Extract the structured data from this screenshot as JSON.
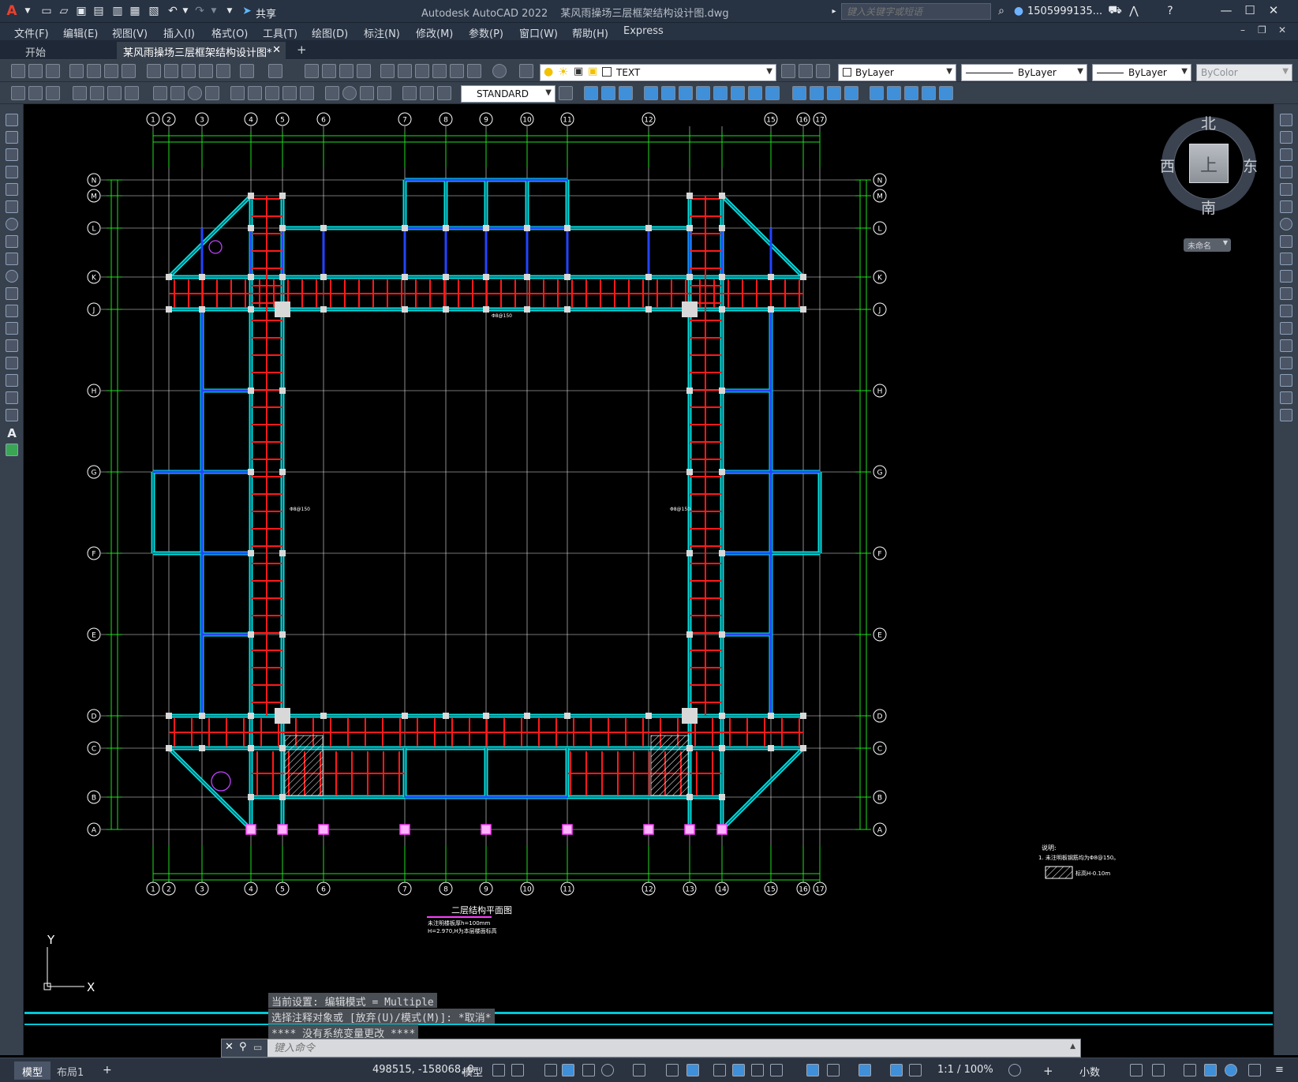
{
  "title_bar": {
    "app_title": "Autodesk AutoCAD 2022",
    "doc_title": "某风雨操场三层框架结构设计图.dwg",
    "share_label": "共享",
    "search_placeholder": "键入关键字或短语",
    "user_name": "1505999135..."
  },
  "menu": [
    "文件(F)",
    "编辑(E)",
    "视图(V)",
    "插入(I)",
    "格式(O)",
    "工具(T)",
    "绘图(D)",
    "标注(N)",
    "修改(M)",
    "参数(P)",
    "窗口(W)",
    "帮助(H)",
    "Express"
  ],
  "tabs": [
    {
      "label": "开始",
      "active": false
    },
    {
      "label": "某风雨操场三层框架结构设计图*",
      "active": true
    }
  ],
  "toolbar": {
    "layer_name": "TEXT",
    "color": "ByLayer",
    "linetype": "ByLayer",
    "lineweight": "ByLayer",
    "plotstyle": "ByColor",
    "dimstyle": "STANDARD"
  },
  "drawing": {
    "col_top": [
      "1",
      "2",
      "3",
      "4",
      "5",
      "6",
      "7",
      "8",
      "9",
      "10",
      "11",
      "12",
      "15",
      "16",
      "17"
    ],
    "col_bottom": [
      "1",
      "2",
      "3",
      "4",
      "5",
      "6",
      "7",
      "8",
      "9",
      "10",
      "11",
      "12",
      "13",
      "14",
      "15",
      "16",
      "17"
    ],
    "rows": [
      "N",
      "M",
      "L",
      "K",
      "J",
      "H",
      "G",
      "F",
      "E",
      "D",
      "C",
      "B",
      "A"
    ],
    "plan_title": "二层结构平面图",
    "plan_note1": "未注明楼板厚h=100mm",
    "plan_note2": "H=2.970,H为本层楼面标高",
    "rebar_label": "Φ8@150",
    "notes_title": "说明:",
    "notes_line1": "1. 未注明板钢筋均为Φ8@150。",
    "notes_legend": "标高H-0.10m",
    "ucs_y": "Y",
    "ucs_x": "X"
  },
  "viewcube": {
    "north": "北",
    "south": "南",
    "east": "东",
    "west": "西",
    "top": "上",
    "wcs": "未命名"
  },
  "command": {
    "history": [
      "当前设置: 编辑模式 = Multiple",
      "选择注释对象或 [放弃(U)/模式(M)]: *取消*",
      "**** 没有系统变量更改 ****"
    ],
    "placeholder": "键入命令"
  },
  "status": {
    "model_tab": "模型",
    "layout_tab": "布局1",
    "coords": "498515, -158068, 0",
    "space": "模型",
    "scale": "1:1 / 100%",
    "units": "小数"
  },
  "colors": {
    "grid": "#e8e8e8",
    "cyan": "#00e0e0",
    "blue": "#2244ff",
    "red": "#ff1a1a",
    "green": "#22dd22",
    "magenta": "#ff40ff"
  }
}
